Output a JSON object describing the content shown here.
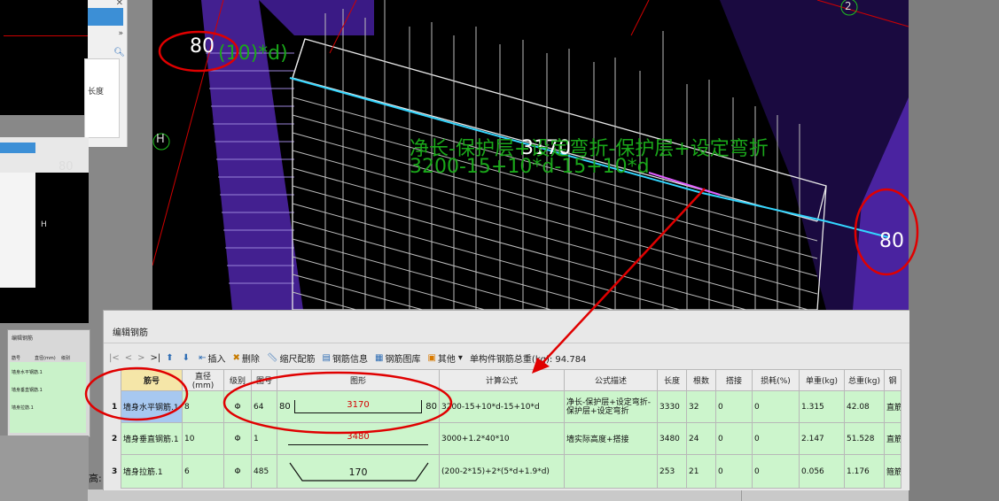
{
  "left_bg": {
    "length_label": "长度",
    "label_80": "80",
    "label_H": "H",
    "mini_title": "编辑钢筋",
    "mini_col1": "筋号",
    "mini_col2": "直径(mm)",
    "mini_col3": "级别",
    "mini_rows": [
      "墙身水平钢筋.1",
      "墙身垂直钢筋.1",
      "墙身拉筋.1"
    ],
    "gao": "高:"
  },
  "view": {
    "label_80_left": "80",
    "label_formula_left": "(10)*d)",
    "label_H": "H",
    "label_2": "2",
    "label_3170": "3170",
    "label_80_right": "80",
    "green_formula_1": "净长-保护层+设定弯折-保护层+设定弯折",
    "green_formula_2": "3200-15+10*d-15+10*d"
  },
  "editor": {
    "title": "编辑钢筋",
    "toolbar": {
      "nav_first": "|<",
      "nav_prev": "<",
      "nav_next": ">",
      "nav_last": ">|",
      "insert": "插入",
      "delete": "删除",
      "ruler": "缩尺配筋",
      "info": "钢筋信息",
      "library": "钢筋图库",
      "other": "其他",
      "total_weight": "单构件钢筋总重(kg): 94.784"
    },
    "columns": [
      "筋号",
      "直径(mm)",
      "级别",
      "图号",
      "图形",
      "计算公式",
      "公式描述",
      "长度",
      "根数",
      "搭接",
      "损耗(%)",
      "单重(kg)",
      "总重(kg)",
      "钢"
    ],
    "rows": [
      {
        "num": "1",
        "name": "墙身水平钢筋.1",
        "dia": "8",
        "grade": "Φ",
        "fig": "64",
        "shape_left": "80",
        "shape_mid": "3170",
        "shape_right": "80",
        "formula": "3200-15+10*d-15+10*d",
        "desc": "净长-保护层+设定弯折-保护层+设定弯折",
        "length": "3330",
        "count": "32",
        "lap": "0",
        "loss": "0",
        "unit_w": "1.315",
        "total_w": "42.08",
        "type": "直筋"
      },
      {
        "num": "2",
        "name": "墙身垂直钢筋.1",
        "dia": "10",
        "grade": "Φ",
        "fig": "1",
        "shape_left": "",
        "shape_mid": "3480",
        "shape_right": "",
        "formula": "3000+1.2*40*10",
        "desc": "墙实际高度+搭接",
        "length": "3480",
        "count": "24",
        "lap": "0",
        "loss": "0",
        "unit_w": "2.147",
        "total_w": "51.528",
        "type": "直筋"
      },
      {
        "num": "3",
        "name": "墙身拉筋.1",
        "dia": "6",
        "grade": "Φ",
        "fig": "485",
        "shape_left": "",
        "shape_mid": "170",
        "shape_right": "",
        "formula": "(200-2*15)+2*(5*d+1.9*d)",
        "desc": "",
        "length": "253",
        "count": "21",
        "lap": "0",
        "loss": "0",
        "unit_w": "0.056",
        "total_w": "1.176",
        "type": "箍筋"
      }
    ]
  },
  "colors": {
    "table_green": "#ccf5cc",
    "annotation_red": "#e00000",
    "formula_green": "#1aa81a",
    "rebar_purple": "#5a2bb0"
  }
}
